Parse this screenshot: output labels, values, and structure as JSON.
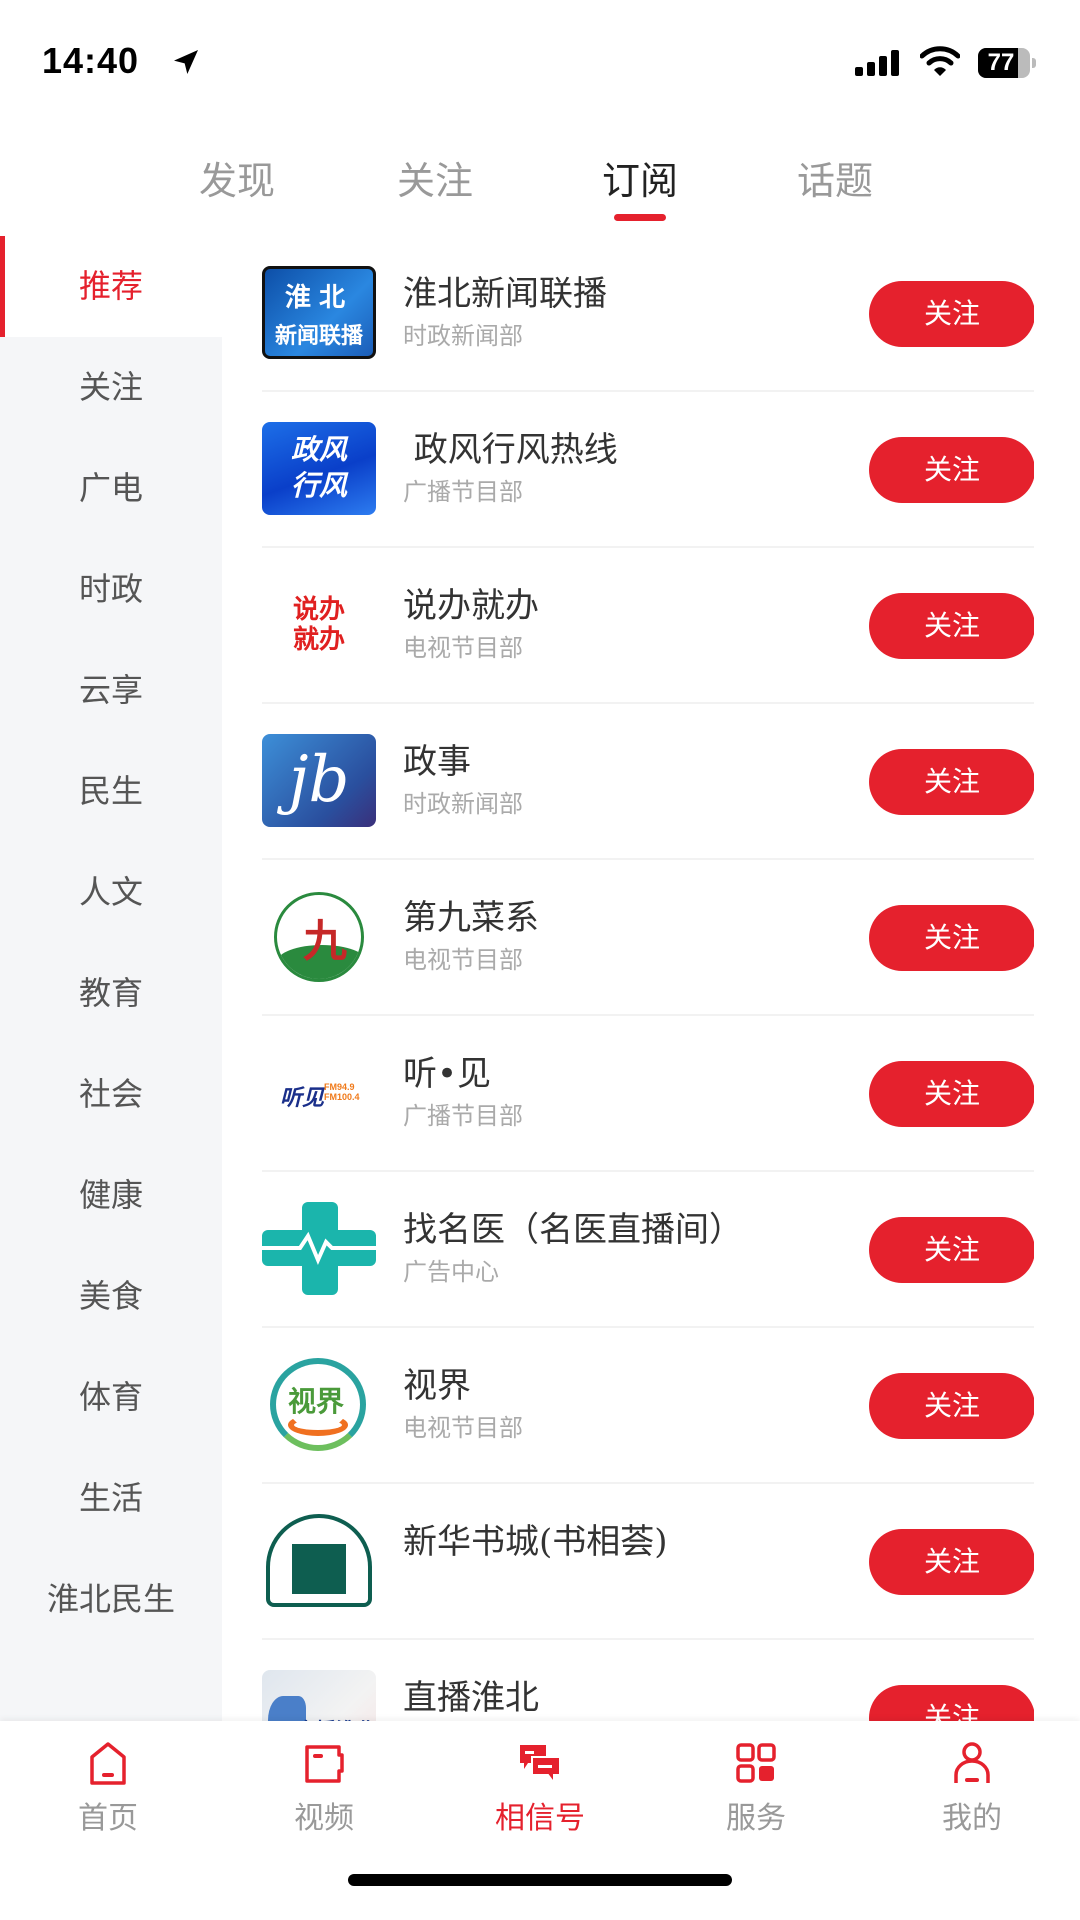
{
  "status_bar": {
    "time": "14:40",
    "battery": "77",
    "battery_level": 0.77
  },
  "top_tabs": [
    {
      "label": "发现",
      "active": false
    },
    {
      "label": "关注",
      "active": false
    },
    {
      "label": "订阅",
      "active": true
    },
    {
      "label": "话题",
      "active": false
    }
  ],
  "sidebar": {
    "active": "推荐",
    "items": [
      "推荐",
      "关注",
      "广电",
      "时政",
      "云享",
      "民生",
      "人文",
      "教育",
      "社会",
      "健康",
      "美食",
      "体育",
      "生活",
      "淮北民生"
    ]
  },
  "accounts": [
    {
      "title": "淮北新闻联播",
      "department": "时政新闻部",
      "follow_label": "关注",
      "logo": {
        "name": "huaibei-news-logo",
        "lines": [
          "淮北",
          "新闻联播"
        ]
      }
    },
    {
      "title": " 政风行风热线",
      "department": "广播节目部",
      "follow_label": "关注",
      "logo": {
        "name": "zhengfeng-logo",
        "lines": [
          "政风",
          "行风"
        ]
      }
    },
    {
      "title": "说办就办",
      "department": "电视节目部",
      "follow_label": "关注",
      "logo": {
        "name": "shuobanjiuban-logo",
        "lines": [
          "说办",
          "就办"
        ]
      }
    },
    {
      "title": "政事",
      "department": "时政新闻部",
      "follow_label": "关注",
      "logo": {
        "name": "zhengshi-logo",
        "lines": [
          "jb"
        ]
      }
    },
    {
      "title": "第九菜系",
      "department": "电视节目部",
      "follow_label": "关注",
      "logo": {
        "name": "ninth-cuisine-logo",
        "lines": [
          "九"
        ]
      }
    },
    {
      "title": "听•见",
      "department": "广播节目部",
      "follow_label": "关注",
      "logo": {
        "name": "tingjian-logo",
        "lines": [
          "听见",
          "FM94.9 FM100.4"
        ]
      }
    },
    {
      "title": "找名医（名医直播间）",
      "department": "广告中心",
      "follow_label": "关注",
      "logo": {
        "name": "medical-cross-logo",
        "lines": []
      }
    },
    {
      "title": "视界",
      "department": "电视节目部",
      "follow_label": "关注",
      "logo": {
        "name": "shijie-logo",
        "lines": [
          "视界"
        ]
      }
    },
    {
      "title": "新华书城(书相荟)",
      "department": "",
      "follow_label": "关注",
      "logo": {
        "name": "xinhua-bookstore-logo",
        "lines": []
      }
    },
    {
      "title": "直播淮北",
      "department": "",
      "follow_label": "关注",
      "logo": {
        "name": "live-huaibei-logo",
        "lines": [
          "直播淮北"
        ]
      }
    }
  ],
  "tabbar": [
    {
      "label": "首页",
      "icon": "home-icon",
      "active": false
    },
    {
      "label": "视频",
      "icon": "video-icon",
      "active": false
    },
    {
      "label": "相信号",
      "icon": "chat-icon",
      "active": true
    },
    {
      "label": "服务",
      "icon": "grid-icon",
      "active": false
    },
    {
      "label": "我的",
      "icon": "user-icon",
      "active": false
    }
  ],
  "colors": {
    "accent": "#e5212d",
    "sidebar_bg": "#f5f6f8",
    "muted_text": "#999999"
  }
}
